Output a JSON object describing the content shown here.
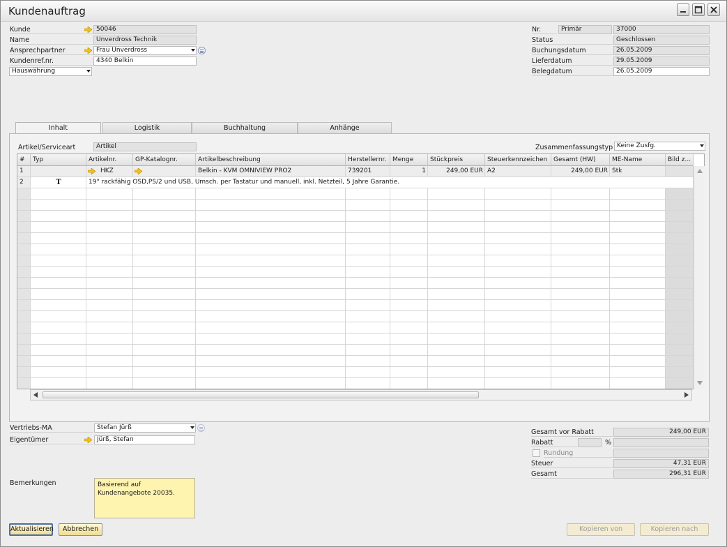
{
  "window": {
    "title": "Kundenauftrag"
  },
  "header_left": {
    "kunde": {
      "label": "Kunde",
      "value": "50046"
    },
    "name": {
      "label": "Name",
      "value": "Unverdross Technik"
    },
    "ansprechpartner": {
      "label": "Ansprechpartner",
      "value": "Frau Unverdross"
    },
    "kundenref": {
      "label": "Kundenref.nr.",
      "value": "4340 Belkin"
    },
    "waehrung": {
      "value": "Hauswährung"
    }
  },
  "header_right": {
    "nr": {
      "label": "Nr.",
      "series": "Primär",
      "value": "37000"
    },
    "status": {
      "label": "Status",
      "value": "Geschlossen"
    },
    "buchungsdatum": {
      "label": "Buchungsdatum",
      "value": "26.05.2009"
    },
    "lieferdatum": {
      "label": "Lieferdatum",
      "value": "29.05.2009"
    },
    "belegdatum": {
      "label": "Belegdatum",
      "value": "26.05.2009"
    }
  },
  "tabs": [
    {
      "label": "Inhalt",
      "active": true
    },
    {
      "label": "Logistik",
      "active": false
    },
    {
      "label": "Buchhaltung",
      "active": false
    },
    {
      "label": "Anhänge",
      "active": false
    }
  ],
  "content": {
    "artikelart_label": "Artikel/Serviceart",
    "artikelart_value": "Artikel",
    "zusammenfassung_label": "Zusammenfassungstyp",
    "zusammenfassung_value": "Keine Zusfg."
  },
  "table": {
    "columns": [
      "#",
      "Typ",
      "Artikelnr.",
      "GP-Katalognr.",
      "Artikelbeschreibung",
      "Herstellernr.",
      "Menge",
      "Stückpreis",
      "Steuerkennzeichen",
      "Gesamt (HW)",
      "ME-Name",
      "Bild z..."
    ],
    "row1": {
      "num": "1",
      "artikelnr": "HKZ",
      "beschreibung": "Belkin - KVM OMNIVIEW PRO2",
      "herstellernr": "739201",
      "menge": "1",
      "stueckpreis": "249,00 EUR",
      "steuer": "A2",
      "gesamt": "249,00 EUR",
      "me": "Stk"
    },
    "row2": {
      "num": "2",
      "typ_icon": "T",
      "text": "19\" rackfähig OSD,PS/2 und USB, Umsch. per Tastatur und manuell, inkl. Netzteil, 5 Jahre Garantie."
    }
  },
  "footer_left": {
    "vertriebs_ma": {
      "label": "Vertriebs-MA",
      "value": "Stefan Jürß"
    },
    "eigentuemer": {
      "label": "Eigentümer",
      "value": "Jürß, Stefan"
    },
    "bemerkungen": {
      "label": "Bemerkungen",
      "value": "Basierend auf\nKundenangebote 20035."
    }
  },
  "totals": {
    "gesamt_vor_rabatt": {
      "label": "Gesamt vor Rabatt",
      "value": "249,00 EUR"
    },
    "rabatt": {
      "label": "Rabatt",
      "percent_sign": "%",
      "percent": "",
      "value": ""
    },
    "rundung": {
      "label": "Rundung",
      "value": ""
    },
    "steuer": {
      "label": "Steuer",
      "value": "47,31 EUR"
    },
    "gesamt": {
      "label": "Gesamt",
      "value": "296,31 EUR"
    }
  },
  "buttons": {
    "aktualisieren": "Aktualisieren",
    "abbrechen": "Abbrechen",
    "kopieren_von": "Kopieren von",
    "kopieren_nach": "Kopieren nach"
  },
  "colors": {
    "arrow": "#f3c21b",
    "note": "#fff3b0",
    "button": "#f0dc92"
  }
}
